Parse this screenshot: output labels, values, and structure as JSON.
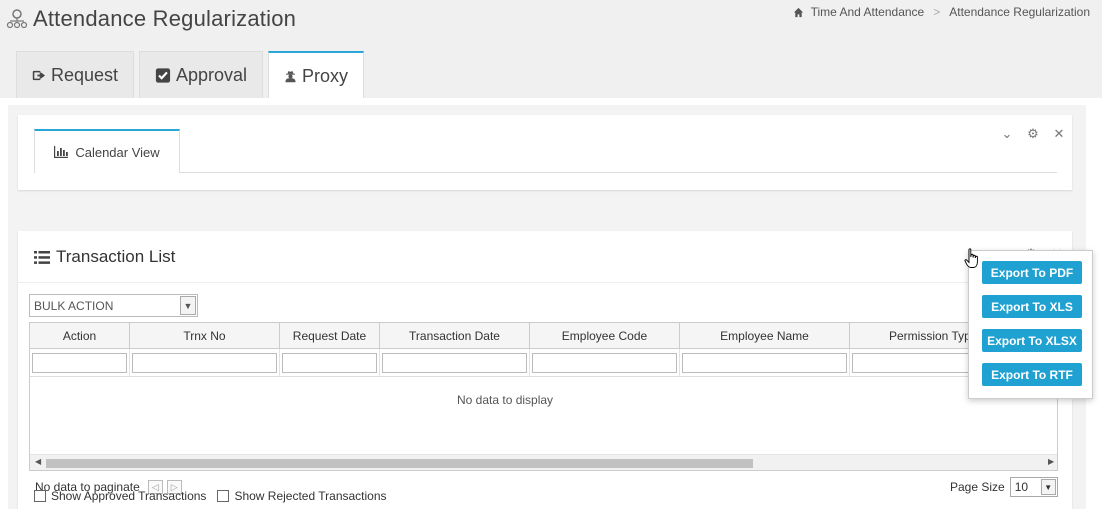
{
  "page": {
    "title": "Attendance Regularization"
  },
  "breadcrumb": {
    "items": [
      "Time And Attendance",
      "Attendance Regularization"
    ],
    "separator": ">"
  },
  "tabs": [
    {
      "label": "Request",
      "icon": "sign-out-icon",
      "active": false
    },
    {
      "label": "Approval",
      "icon": "checkbox-icon",
      "active": false
    },
    {
      "label": "Proxy",
      "icon": "user-secret-icon",
      "active": true
    }
  ],
  "calendar_panel": {
    "tab_label": "Calendar View",
    "tab_icon": "bar-chart-icon"
  },
  "transaction_list": {
    "title": "Transaction List",
    "bulk_action": "BULK ACTION",
    "columns": [
      "Action",
      "Trnx No",
      "Request Date",
      "Transaction Date",
      "Employee Code",
      "Employee Name",
      "Permission Type"
    ],
    "no_data": "No data to display",
    "pager_text": "No data to paginate",
    "page_size_label": "Page Size",
    "page_size_value": "10"
  },
  "export_menu": [
    "Export To PDF",
    "Export To XLS",
    "Export To XLSX",
    "Export To RTF"
  ],
  "checkboxes": [
    "Show Approved Transactions",
    "Show Rejected Transactions"
  ],
  "colors": {
    "accent": "#2aa5d8",
    "button": "#1fa1d2"
  }
}
